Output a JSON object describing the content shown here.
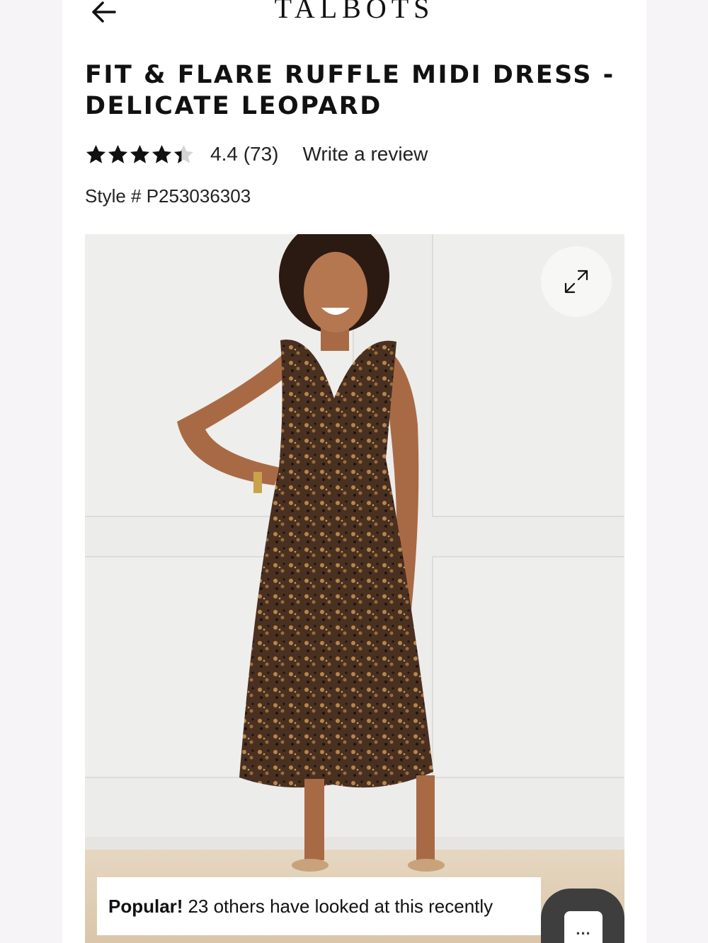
{
  "header": {
    "back_icon": "arrow-left-icon",
    "logo_text": "TALBOTS"
  },
  "product": {
    "title": "FIT & FLARE RUFFLE MIDI DRESS - DELICATE LEOPARD",
    "rating_value": 4.4,
    "max_rating": 5,
    "rating_text": "4.4 (73)",
    "write_review_label": "Write a review",
    "style_number": "Style # P253036303"
  },
  "gallery": {
    "expand_icon": "expand-arrows-icon"
  },
  "popular": {
    "label": "Popular!",
    "text": "23 others have looked at this recently"
  },
  "chat": {
    "icon": "chat-bubble-icon",
    "dots": "..."
  },
  "colors": {
    "text": "#111111",
    "chat_button": "#3e3e3e",
    "star_filled": "#111111",
    "star_empty": "#d4d4d4"
  }
}
